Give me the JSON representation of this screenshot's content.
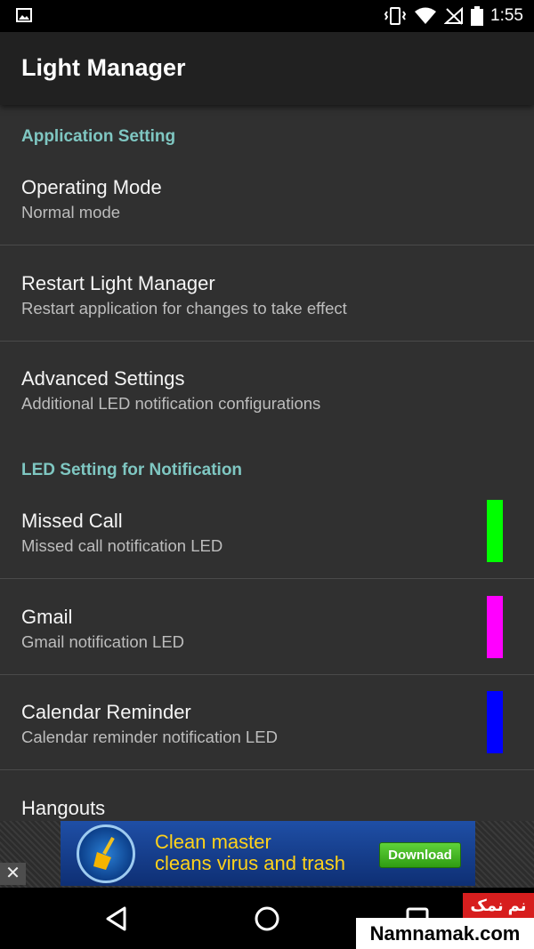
{
  "status_bar": {
    "time": "1:55",
    "icons": [
      "image-icon",
      "vibrate-icon",
      "wifi-icon",
      "no-signal-icon",
      "battery-icon"
    ]
  },
  "app_bar": {
    "title": "Light Manager"
  },
  "sections": {
    "application": {
      "header": "Application Setting",
      "items": [
        {
          "title": "Operating Mode",
          "summary": "Normal mode"
        },
        {
          "title": "Restart Light Manager",
          "summary": "Restart application for changes to take effect"
        },
        {
          "title": "Advanced Settings",
          "summary": "Additional LED notification configurations"
        }
      ]
    },
    "led": {
      "header": "LED Setting for Notification",
      "items": [
        {
          "title": "Missed Call",
          "summary": "Missed call notification LED",
          "color": "#00ff00"
        },
        {
          "title": "Gmail",
          "summary": "Gmail notification LED",
          "color": "#ff00ff"
        },
        {
          "title": "Calendar Reminder",
          "summary": "Calendar reminder notification LED",
          "color": "#0000ff"
        },
        {
          "title": "Hangouts",
          "summary": ""
        }
      ]
    }
  },
  "ad": {
    "line1": "Clean master",
    "line2": "cleans virus and trash",
    "button": "Download",
    "close": "✕"
  },
  "nav_bar": {
    "icons": [
      "back-icon",
      "home-icon",
      "recents-icon"
    ]
  },
  "watermark": {
    "persian": "نم نمک",
    "site": "Namnamak.com"
  },
  "colors": {
    "accent": "#7fc7c2",
    "background": "#303030",
    "app_bar": "#212121"
  }
}
